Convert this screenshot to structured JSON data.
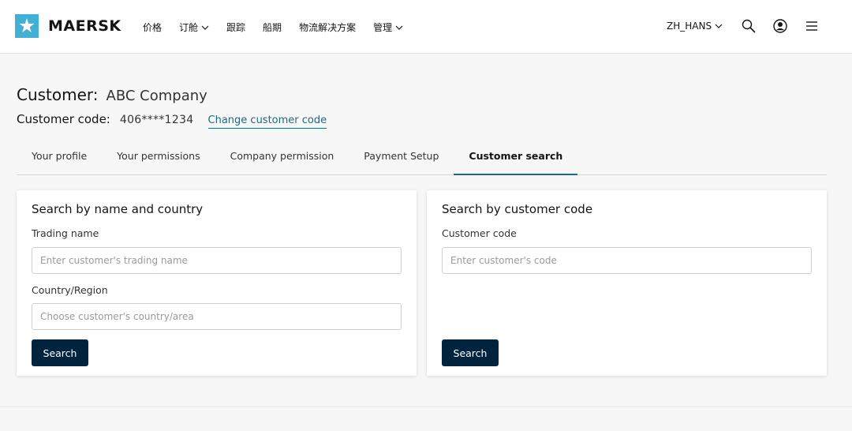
{
  "header": {
    "brand": "MAERSK",
    "nav": [
      {
        "label": "价格",
        "has_dropdown": false
      },
      {
        "label": "订舱",
        "has_dropdown": true
      },
      {
        "label": "跟踪",
        "has_dropdown": false
      },
      {
        "label": "船期",
        "has_dropdown": false
      },
      {
        "label": "物流解决方案",
        "has_dropdown": false
      },
      {
        "label": "管理",
        "has_dropdown": true
      }
    ],
    "language": "ZH_HANS",
    "icons": [
      "search-icon",
      "user-icon",
      "menu-icon"
    ],
    "accent_color": "#42b0d5"
  },
  "customer": {
    "label": "Customer:",
    "name": "ABC Company",
    "code_label": "Customer code:",
    "code_value": "406****1234",
    "change_link": "Change customer code"
  },
  "tabs": [
    {
      "label": "Your profile",
      "active": false
    },
    {
      "label": "Your permissions",
      "active": false
    },
    {
      "label": "Company permission",
      "active": false
    },
    {
      "label": "Payment Setup",
      "active": false
    },
    {
      "label": "Customer search",
      "active": true
    }
  ],
  "search_by_name": {
    "title": "Search by name and country",
    "trading_name_label": "Trading name",
    "trading_name_value": "",
    "trading_name_placeholder": "Enter customer's trading name",
    "country_label": "Country/Region",
    "country_value": "",
    "country_placeholder": "Choose customer's country/area",
    "button": "Search"
  },
  "search_by_code": {
    "title": "Search by customer code",
    "code_label": "Customer code",
    "code_value": "",
    "code_placeholder": "Enter customer's code",
    "button": "Search"
  },
  "colors": {
    "primary_button": "#00243d",
    "link": "#1b6a84"
  }
}
